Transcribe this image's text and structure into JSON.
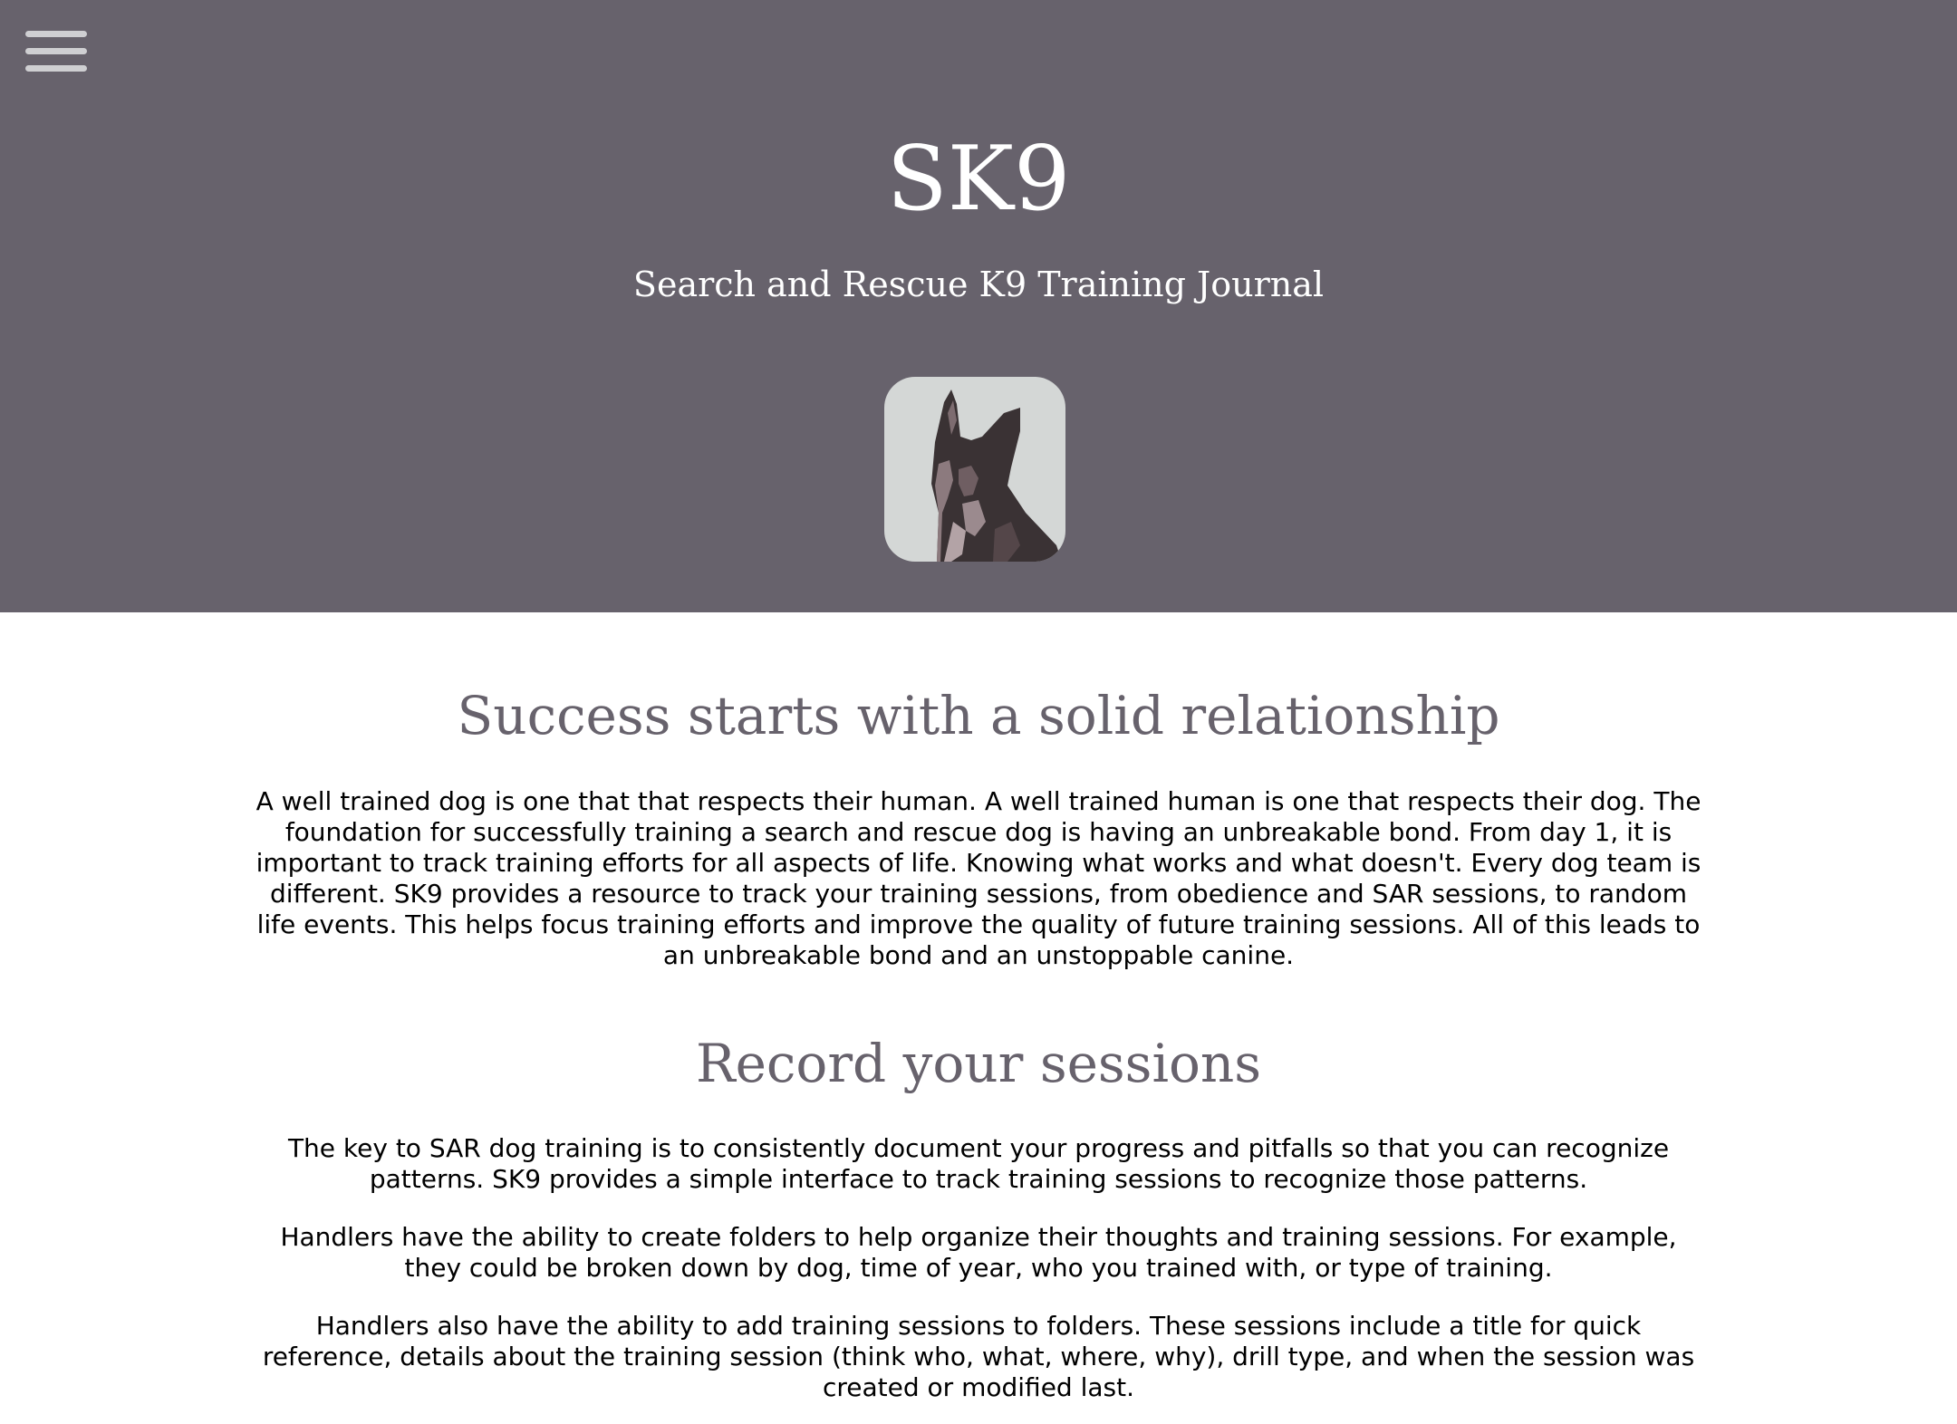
{
  "hero": {
    "title": "SK9",
    "subtitle": "Search and Rescue K9 Training Journal",
    "menu_icon": "hamburger-menu-icon",
    "logo": "dog-silhouette-logo"
  },
  "colors": {
    "hero_bg": "#67626c",
    "heading": "#67626c",
    "logo_bg": "#d4d7d6",
    "body_text": "#000000"
  },
  "sections": [
    {
      "heading": "Success starts with a solid relationship",
      "paragraphs": [
        "A well trained dog is one that that respects their human. A well trained human is one that respects their dog. The foundation for successfully training a search and rescue dog is having an unbreakable bond. From day 1, it is important to track training efforts for all aspects of life. Knowing what works and what doesn't. Every dog team is different. SK9 provides a resource to track your training sessions, from obedience and SAR sessions, to random life events. This helps focus training efforts and improve the quality of future training sessions. All of this leads to an unbreakable bond and an unstoppable canine."
      ]
    },
    {
      "heading": "Record your sessions",
      "paragraphs": [
        "The key to SAR dog training is to consistently document your progress and pitfalls so that you can recognize patterns. SK9 provides a simple interface to track training sessions to recognize those patterns.",
        "Handlers have the ability to create folders to help organize their thoughts and training sessions. For example, they could be broken down by dog, time of year, who you trained with, or type of training.",
        "Handlers also have the ability to add training sessions to folders. These sessions include a title for quick reference, details about the training session (think who, what, where, why), drill type, and when the session was created or modified last."
      ]
    }
  ]
}
